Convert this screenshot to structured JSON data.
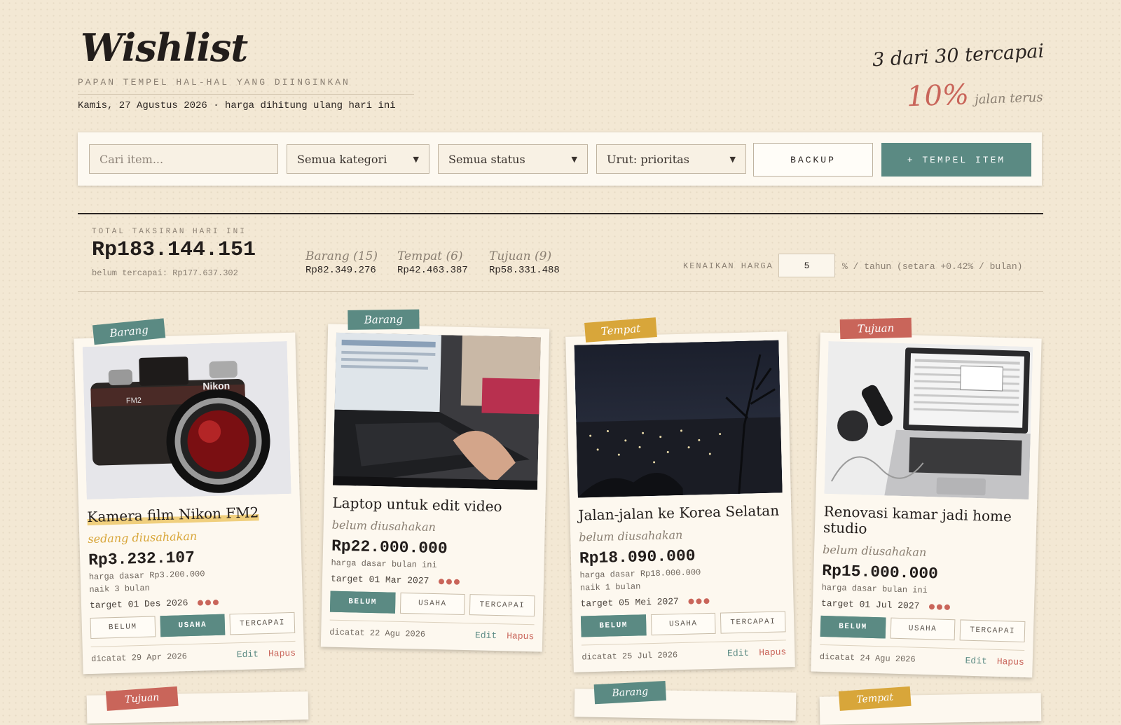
{
  "header": {
    "title": "Wishlist",
    "subtitle": "PAPAN TEMPEL HAL-HAL YANG DIINGINKAN",
    "dateline": "Kamis, 27 Agustus 2026 · harga dihitung ulang hari ini",
    "progress_count": "3 dari 30 tercapai",
    "progress_percent": "10%",
    "progress_note": "jalan terus"
  },
  "toolbar": {
    "search_placeholder": "Cari item...",
    "category_select": "Semua kategori",
    "status_select": "Semua status",
    "sort_select": "Urut: prioritas",
    "backup_label": "BACKUP",
    "add_label": "+ TEMPEL ITEM"
  },
  "stats": {
    "total_label": "TOTAL TAKSIRAN HARI INI",
    "total_value": "Rp183.144.151",
    "remaining": "belum tercapai: Rp177.637.302",
    "categories": [
      {
        "name": "Barang (15)",
        "value": "Rp82.349.276"
      },
      {
        "name": "Tempat (6)",
        "value": "Rp42.463.387"
      },
      {
        "name": "Tujuan (9)",
        "value": "Rp58.331.488"
      }
    ],
    "inflation_label": "KENAIKAN HARGA",
    "inflation_value": "5",
    "inflation_note": "% / tahun (setara +0.42% / bulan)"
  },
  "colors": {
    "teal": "#5b8a83",
    "coral": "#c9655a",
    "mustard": "#d8a63a",
    "paper": "#fdf8ef"
  },
  "status_buttons": [
    "BELUM",
    "USAHA",
    "TERCAPAI"
  ],
  "cards": [
    {
      "tag": "Barang",
      "name": "Kamera film Nikon FM2",
      "status": "sedang diusahakan",
      "price": "Rp3.232.107",
      "note1": "harga dasar Rp3.200.000",
      "note2": "naik 3 bulan",
      "target": "target 01 Des 2026",
      "recorded": "dicatat 29 Apr 2026",
      "edit": "Edit",
      "delete": "Hapus"
    },
    {
      "tag": "Barang",
      "name": "Laptop untuk edit video",
      "status": "belum diusahakan",
      "price": "Rp22.000.000",
      "note1": "harga dasar bulan ini",
      "note2": "",
      "target": "target 01 Mar 2027",
      "recorded": "dicatat 22 Agu 2026",
      "edit": "Edit",
      "delete": "Hapus"
    },
    {
      "tag": "Tempat",
      "name": "Jalan-jalan ke Korea Selatan",
      "status": "belum diusahakan",
      "price": "Rp18.090.000",
      "note1": "harga dasar Rp18.000.000",
      "note2": "naik 1 bulan",
      "target": "target 05 Mei 2027",
      "recorded": "dicatat 25 Jul 2026",
      "edit": "Edit",
      "delete": "Hapus"
    },
    {
      "tag": "Tujuan",
      "name": "Renovasi kamar jadi home studio",
      "status": "belum diusahakan",
      "price": "Rp15.000.000",
      "note1": "harga dasar bulan ini",
      "note2": "",
      "target": "target 01 Jul 2027",
      "recorded": "dicatat 24 Agu 2026",
      "edit": "Edit",
      "delete": "Hapus"
    }
  ],
  "peek_tags": [
    "Tujuan",
    "Barang",
    "Tempat"
  ]
}
